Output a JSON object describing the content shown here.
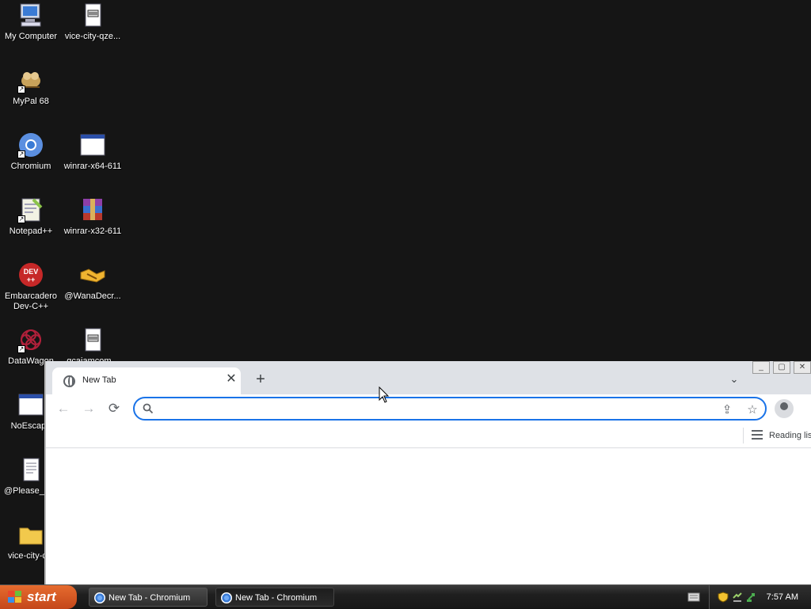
{
  "desktop": {
    "icons": [
      {
        "label": "My Computer"
      },
      {
        "label": "vice-city-qze..."
      },
      {
        "label": "MyPal 68"
      },
      {
        "label": "Chromium"
      },
      {
        "label": "winrar-x64-611"
      },
      {
        "label": "Notepad++"
      },
      {
        "label": "winrar-x32-611"
      },
      {
        "label": "Embarcadero Dev-C++"
      },
      {
        "label": "@WanaDecr..."
      },
      {
        "label": "DataWagon"
      },
      {
        "label": "gcaiamcom..."
      },
      {
        "label": "NoEscape"
      },
      {
        "label": "@Please_R..."
      },
      {
        "label": "vice-city-c..."
      }
    ]
  },
  "browser": {
    "tab_title": "New Tab",
    "omnibox_value": "",
    "reading_list_label": "Reading list"
  },
  "taskbar": {
    "start_label": "start",
    "buttons": [
      {
        "label": "New Tab - Chromium"
      },
      {
        "label": "New Tab - Chromium"
      }
    ],
    "clock": "7:57 AM"
  },
  "colors": {
    "focus_ring": "#1a73e8",
    "tabstrip": "#dee1e6",
    "start_button": "#d4561f"
  }
}
